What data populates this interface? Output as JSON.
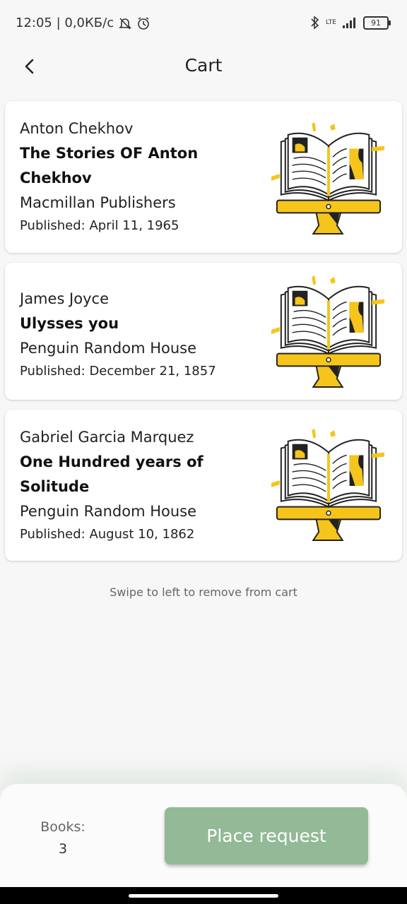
{
  "status_bar": {
    "time_speed": "12:05 | 0,0КБ/с",
    "network": "LTE",
    "battery": "91"
  },
  "app_bar": {
    "title": "Cart",
    "back_icon": "chevron-left-icon"
  },
  "cart": {
    "items": [
      {
        "author": "Anton Chekhov",
        "title": "The Stories OF Anton Chekhov",
        "publisher": "Macmillan Publishers",
        "published": "Published: April 11, 1965"
      },
      {
        "author": "James Joyce",
        "title": "Ulysses you",
        "publisher": "Penguin Random House",
        "published": "Published: December 21, 1857"
      },
      {
        "author": "Gabriel Garcia Marquez",
        "title": "One Hundred years of Solitude",
        "publisher": "Penguin Random House",
        "published": "Published: August 10, 1862"
      }
    ],
    "hint": "Swipe to left to remove from cart"
  },
  "footer": {
    "books_label": "Books:",
    "books_count": "3",
    "place_request_label": "Place request"
  },
  "colors": {
    "accent_button": "#93b996",
    "illustration_yellow": "#f6c51b",
    "background": "#f7f7f7"
  }
}
